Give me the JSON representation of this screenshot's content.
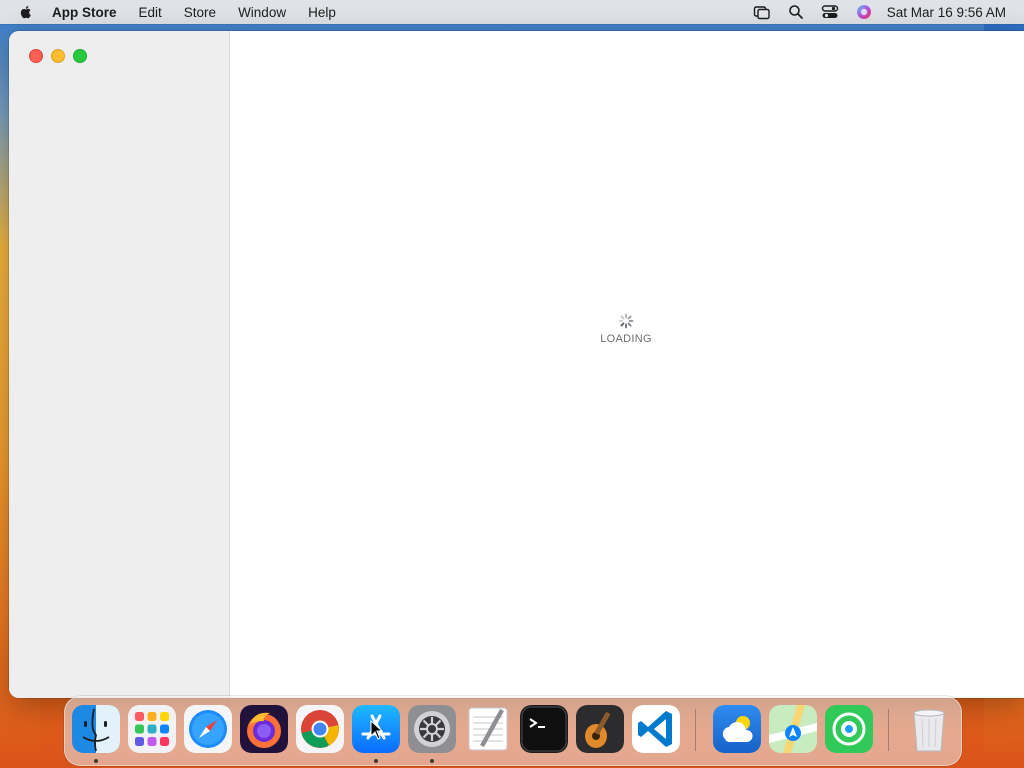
{
  "menubar": {
    "app_name": "App Store",
    "menus": [
      "Edit",
      "Store",
      "Window",
      "Help"
    ],
    "clock": "Sat Mar 16  9:56 AM",
    "status_icons": [
      "screen-mirroring-icon",
      "spotlight-search-icon",
      "control-center-icon",
      "siri-icon"
    ]
  },
  "window": {
    "loading_text": "LOADING"
  },
  "dock": {
    "items": [
      {
        "name": "finder",
        "running": true
      },
      {
        "name": "launchpad",
        "running": false
      },
      {
        "name": "safari",
        "running": false
      },
      {
        "name": "firefox",
        "running": false
      },
      {
        "name": "chrome",
        "running": false
      },
      {
        "name": "app-store",
        "running": true
      },
      {
        "name": "system-settings",
        "running": true
      },
      {
        "name": "textedit",
        "running": false
      },
      {
        "name": "terminal",
        "running": false
      },
      {
        "name": "garageband",
        "running": false
      },
      {
        "name": "vscode",
        "running": false
      },
      {
        "name": "weather",
        "running": false
      },
      {
        "name": "maps",
        "running": false
      },
      {
        "name": "find-my",
        "running": false
      },
      {
        "name": "trash",
        "running": false
      }
    ]
  },
  "colors": {
    "close": "#ff5f57",
    "minimize": "#febc2e",
    "maximize": "#28c840"
  }
}
